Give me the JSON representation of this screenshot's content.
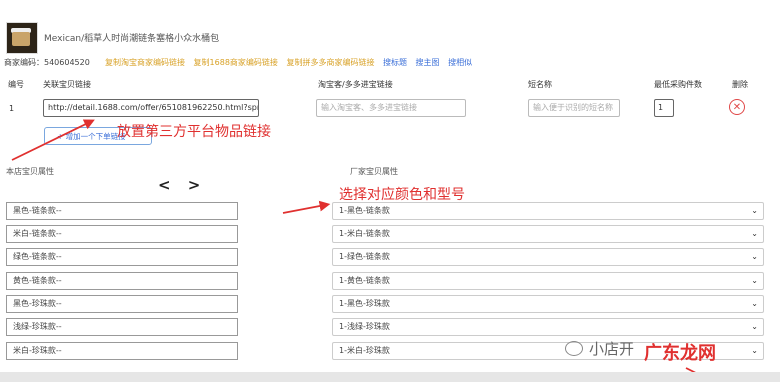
{
  "product": {
    "title": "Mexican/稻草人时尚潮链条塞格小众水桶包",
    "thumb_icon": "product-thumbnail-bag"
  },
  "merchant": {
    "label": "商家编码：",
    "code": "540604520",
    "links": [
      {
        "label": "复制淘宝商家编码链接",
        "color": "#d8a126"
      },
      {
        "label": "复制1688商家编码链接",
        "color": "#d8a126"
      },
      {
        "label": "复制拼多多商家编码链接",
        "color": "#d8a126"
      },
      {
        "label": "搜标题",
        "color": "#3b6fd8"
      },
      {
        "label": "搜主图",
        "color": "#3b6fd8"
      },
      {
        "label": "搜相似",
        "color": "#3b6fd8"
      }
    ]
  },
  "table": {
    "headers": {
      "num": "编号",
      "link": "关联宝贝链接",
      "taobao": "淘宝客/多多进宝链接",
      "short_name": "短名称",
      "min_qty": "最低采购件数",
      "delete": "删除"
    },
    "row": {
      "num": "1",
      "link_value": "http://detail.1688.com/offer/651081962250.html?spm=",
      "taobao_placeholder": "输入淘宝客、多多进宝链接",
      "short_name_placeholder": "输入便于识别的短名称",
      "min_qty": "1",
      "delete_icon": "close-circle-icon"
    },
    "add_button": "+ 增加一个下单链接"
  },
  "annotations": {
    "first": "放置第三方平台物品链接",
    "second": "选择对应颜色和型号"
  },
  "mapping": {
    "left_title": "本店宝贝属性",
    "right_title": "厂家宝贝属性",
    "pager": "< >",
    "rows": [
      {
        "store": "黑色-链条款--",
        "vendor": "1-黑色-链条款"
      },
      {
        "store": "米白-链条款--",
        "vendor": "1-米白-链条款"
      },
      {
        "store": "绿色-链条款--",
        "vendor": "1-绿色-链条款"
      },
      {
        "store": "黄色-链条款--",
        "vendor": "1-黄色-链条款"
      },
      {
        "store": "黑色-珍珠款--",
        "vendor": "1-黑色-珍珠款"
      },
      {
        "store": "浅绿-珍珠款--",
        "vendor": "1-浅绿-珍珠款"
      },
      {
        "store": "米白-珍珠款--",
        "vendor": "1-米白-珍珠款"
      }
    ]
  },
  "watermark": {
    "text": "小店开",
    "brand": "广东龙网"
  },
  "colors": {
    "annotation_red": "#e0302f",
    "link_gold": "#d8a126",
    "link_blue": "#3b6fd8"
  }
}
